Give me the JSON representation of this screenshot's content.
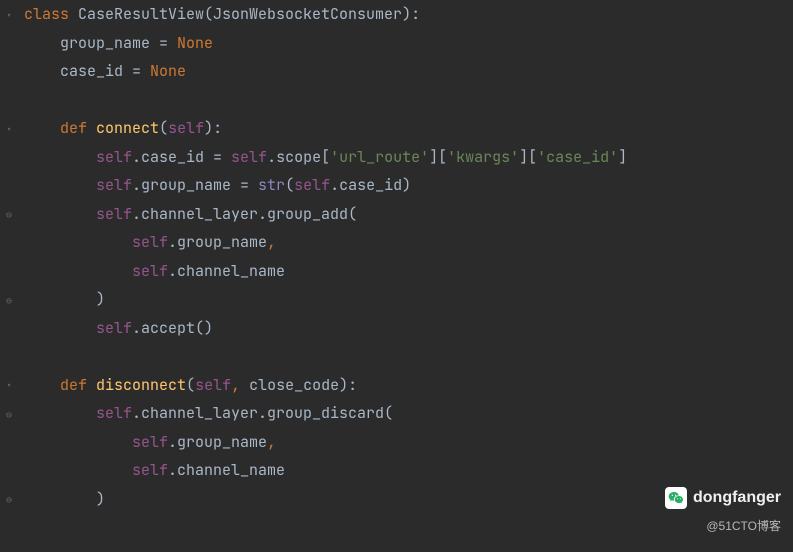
{
  "code": {
    "lines": [
      {
        "indent": 0,
        "tokens": [
          {
            "t": "kw",
            "v": "class "
          },
          {
            "t": "cls",
            "v": "CaseResultView"
          },
          {
            "t": "punct",
            "v": "("
          },
          {
            "t": "cls",
            "v": "JsonWebsocketConsumer"
          },
          {
            "t": "punct",
            "v": "):"
          }
        ]
      },
      {
        "indent": 1,
        "tokens": [
          {
            "t": "cls",
            "v": "group_name "
          },
          {
            "t": "punct",
            "v": "= "
          },
          {
            "t": "none",
            "v": "None"
          }
        ]
      },
      {
        "indent": 1,
        "tokens": [
          {
            "t": "cls",
            "v": "case_id "
          },
          {
            "t": "punct",
            "v": "= "
          },
          {
            "t": "none",
            "v": "None"
          }
        ]
      },
      {
        "indent": 0,
        "tokens": []
      },
      {
        "indent": 1,
        "tokens": [
          {
            "t": "kw",
            "v": "def "
          },
          {
            "t": "func",
            "v": "connect"
          },
          {
            "t": "punct",
            "v": "("
          },
          {
            "t": "self",
            "v": "self"
          },
          {
            "t": "punct",
            "v": "):"
          }
        ]
      },
      {
        "indent": 2,
        "tokens": [
          {
            "t": "self",
            "v": "self"
          },
          {
            "t": "punct",
            "v": ".case_id = "
          },
          {
            "t": "self",
            "v": "self"
          },
          {
            "t": "punct",
            "v": ".scope["
          },
          {
            "t": "str",
            "v": "'url_route'"
          },
          {
            "t": "punct",
            "v": "]["
          },
          {
            "t": "str",
            "v": "'kwargs'"
          },
          {
            "t": "punct",
            "v": "]["
          },
          {
            "t": "str",
            "v": "'case_id'"
          },
          {
            "t": "punct",
            "v": "]"
          }
        ]
      },
      {
        "indent": 2,
        "tokens": [
          {
            "t": "self",
            "v": "self"
          },
          {
            "t": "punct",
            "v": ".group_name = "
          },
          {
            "t": "builtin",
            "v": "str"
          },
          {
            "t": "punct",
            "v": "("
          },
          {
            "t": "self",
            "v": "self"
          },
          {
            "t": "punct",
            "v": ".case_id)"
          }
        ]
      },
      {
        "indent": 2,
        "tokens": [
          {
            "t": "self",
            "v": "self"
          },
          {
            "t": "punct",
            "v": ".channel_layer.group_add("
          }
        ]
      },
      {
        "indent": 3,
        "tokens": [
          {
            "t": "self",
            "v": "self"
          },
          {
            "t": "punct",
            "v": ".group_name"
          },
          {
            "t": "comma",
            "v": ","
          }
        ]
      },
      {
        "indent": 3,
        "tokens": [
          {
            "t": "self",
            "v": "self"
          },
          {
            "t": "punct",
            "v": ".channel_name"
          }
        ]
      },
      {
        "indent": 2,
        "tokens": [
          {
            "t": "punct",
            "v": ")"
          }
        ]
      },
      {
        "indent": 2,
        "tokens": [
          {
            "t": "self",
            "v": "self"
          },
          {
            "t": "punct",
            "v": ".accept()"
          }
        ]
      },
      {
        "indent": 0,
        "tokens": []
      },
      {
        "indent": 1,
        "tokens": [
          {
            "t": "kw",
            "v": "def "
          },
          {
            "t": "func",
            "v": "disconnect"
          },
          {
            "t": "punct",
            "v": "("
          },
          {
            "t": "self",
            "v": "self"
          },
          {
            "t": "comma",
            "v": ", "
          },
          {
            "t": "cls",
            "v": "close_code"
          },
          {
            "t": "punct",
            "v": "):"
          }
        ]
      },
      {
        "indent": 2,
        "tokens": [
          {
            "t": "self",
            "v": "self"
          },
          {
            "t": "punct",
            "v": ".channel_layer.group_discard("
          }
        ]
      },
      {
        "indent": 3,
        "tokens": [
          {
            "t": "self",
            "v": "self"
          },
          {
            "t": "punct",
            "v": ".group_name"
          },
          {
            "t": "comma",
            "v": ","
          }
        ]
      },
      {
        "indent": 3,
        "tokens": [
          {
            "t": "self",
            "v": "self"
          },
          {
            "t": "punct",
            "v": ".channel_name"
          }
        ]
      },
      {
        "indent": 2,
        "tokens": [
          {
            "t": "punct",
            "v": ")"
          }
        ]
      }
    ]
  },
  "gutter_marks": [
    {
      "line": 0,
      "glyph": "▾"
    },
    {
      "line": 4,
      "glyph": "▾"
    },
    {
      "line": 7,
      "glyph": "⊖"
    },
    {
      "line": 10,
      "glyph": "⊖"
    },
    {
      "line": 13,
      "glyph": "▾"
    },
    {
      "line": 14,
      "glyph": "⊖"
    },
    {
      "line": 17,
      "glyph": "⊖"
    }
  ],
  "watermark": {
    "name": "dongfanger",
    "sub": "@51CTO博客"
  }
}
